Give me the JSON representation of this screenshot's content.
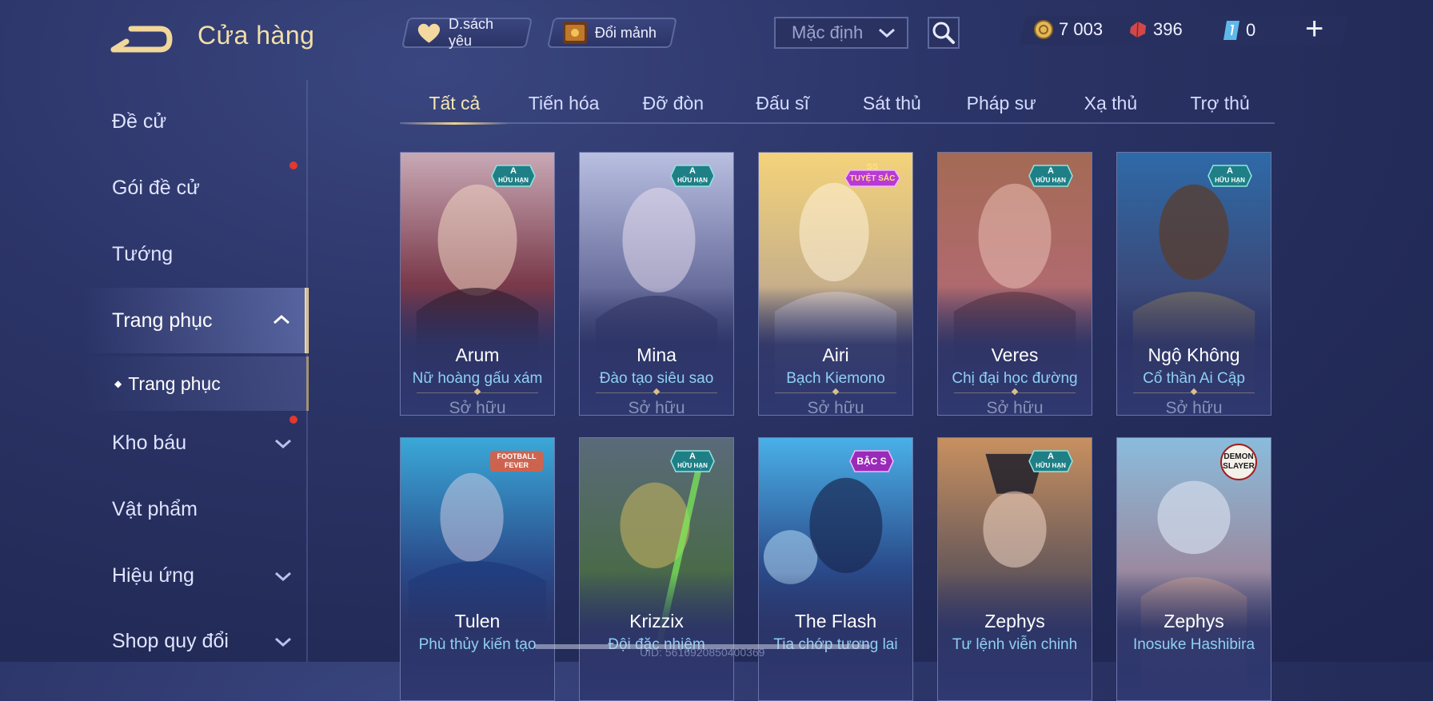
{
  "header": {
    "title": "Cửa hàng",
    "favorites_label": "D.sách yêu",
    "exchange_label": "Đổi mảnh",
    "sort_value": "Mặc định"
  },
  "currency": {
    "gold": "7 003",
    "vouchers": "396",
    "tokens": "0"
  },
  "sidebar": {
    "items": [
      {
        "label": "Đề cử"
      },
      {
        "label": "Gói đề cử"
      },
      {
        "label": "Tướng"
      },
      {
        "label": "Trang phục"
      },
      {
        "label": "Trang phục"
      },
      {
        "label": "Kho báu"
      },
      {
        "label": "Vật phẩm"
      },
      {
        "label": "Hiệu ứng"
      },
      {
        "label": "Shop quy đổi"
      }
    ]
  },
  "tabs": [
    {
      "label": "Tất cả"
    },
    {
      "label": "Tiến hóa"
    },
    {
      "label": "Đỡ đòn"
    },
    {
      "label": "Đấu sĩ"
    },
    {
      "label": "Sát thủ"
    },
    {
      "label": "Pháp sư"
    },
    {
      "label": "Xạ thủ"
    },
    {
      "label": "Trợ thủ"
    }
  ],
  "cards": [
    {
      "hero": "Arum",
      "skin": "Nữ hoàng gấu xám",
      "status": "Sở hữu",
      "badge_top": "A",
      "badge_bottom": "HỮU HẠN"
    },
    {
      "hero": "Mina",
      "skin": "Đào tạo siêu sao",
      "status": "Sở hữu",
      "badge_top": "A",
      "badge_bottom": "HỮU HẠN"
    },
    {
      "hero": "Airi",
      "skin": "Bạch Kiemono",
      "status": "Sở hữu",
      "badge_top": "SS",
      "badge_bottom": "TUYỆT SẮC"
    },
    {
      "hero": "Veres",
      "skin": "Chị đại học đường",
      "status": "Sở hữu",
      "badge_top": "A",
      "badge_bottom": "HỮU HẠN"
    },
    {
      "hero": "Ngộ Không",
      "skin": "Cổ thần Ai Cập",
      "status": "Sở hữu",
      "badge_top": "A",
      "badge_bottom": "HỮU HẠN"
    },
    {
      "hero": "Tulen",
      "skin": "Phù thủy kiến tạo",
      "badge_top": "FOOTBALL",
      "badge_bottom": "FEVER"
    },
    {
      "hero": "Krizzix",
      "skin": "Đội đặc nhiệm",
      "badge_top": "A",
      "badge_bottom": "HỮU HẠN"
    },
    {
      "hero": "The Flash",
      "skin": "Tia chớp tương lai",
      "badge_top": "BẬC S",
      "badge_bottom": ""
    },
    {
      "hero": "Zephys",
      "skin": "Tư lệnh viễn chinh",
      "badge_top": "A",
      "badge_bottom": "HỮU HẠN"
    },
    {
      "hero": "Zephys",
      "skin": "Inosuke Hashibira",
      "badge_top": "DEMON",
      "badge_bottom": "SLAYER"
    }
  ],
  "footer": {
    "uid": "UID: 5616920850400369"
  },
  "colors": {
    "accent_gold": "#f1d79a",
    "skin_name_blue": "#8fd0f2",
    "badge_teal": "#2fa6a0",
    "badge_purple": "#b83ad6",
    "notification_red": "#e3382c"
  }
}
